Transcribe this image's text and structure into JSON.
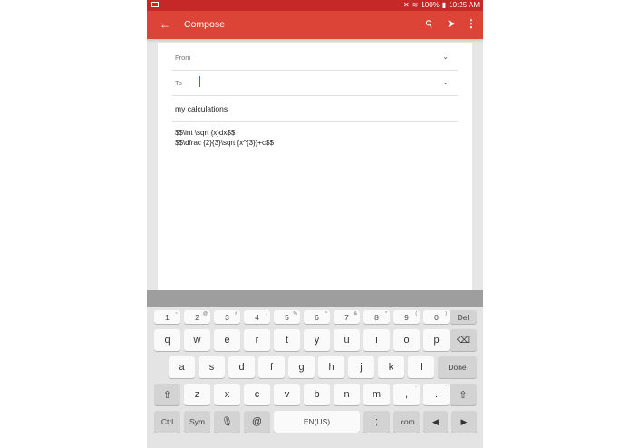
{
  "status_bar": {
    "battery": "100%",
    "time": "10:25 AM"
  },
  "app_bar": {
    "title": "Compose"
  },
  "compose": {
    "from_label": "From",
    "to_label": "To",
    "subject": "my calculations",
    "body_lines": [
      "$$\\int \\sqrt {x}dx$$",
      "$$\\dfrac {2}{3}\\sqrt {x^{3}}+c$$"
    ]
  },
  "keyboard": {
    "row1": [
      {
        "main": "1",
        "sup": "~"
      },
      {
        "main": "2",
        "sup": "@"
      },
      {
        "main": "3",
        "sup": "#"
      },
      {
        "main": "4",
        "sup": "/"
      },
      {
        "main": "5",
        "sup": "%"
      },
      {
        "main": "6",
        "sup": "^"
      },
      {
        "main": "7",
        "sup": "&"
      },
      {
        "main": "8",
        "sup": "*"
      },
      {
        "main": "9",
        "sup": "("
      },
      {
        "main": "0",
        "sup": ")"
      },
      {
        "main": "Del",
        "sup": ""
      }
    ],
    "row2": [
      "q",
      "w",
      "e",
      "r",
      "t",
      "y",
      "u",
      "i",
      "o",
      "p"
    ],
    "row3": [
      "a",
      "s",
      "d",
      "f",
      "g",
      "h",
      "j",
      "k",
      "l"
    ],
    "done": "Done",
    "row4": [
      "z",
      "x",
      "c",
      "v",
      "b",
      "n",
      "m",
      ",",
      "."
    ],
    "row4_sup": [
      "",
      "",
      "",
      "",
      "",
      "",
      "",
      "-",
      "\""
    ],
    "ctrl": "Ctrl",
    "sym": "Sym",
    "at": "@",
    "space": "EN(US)",
    "semicolon": ";",
    "dotcom": ".com"
  }
}
